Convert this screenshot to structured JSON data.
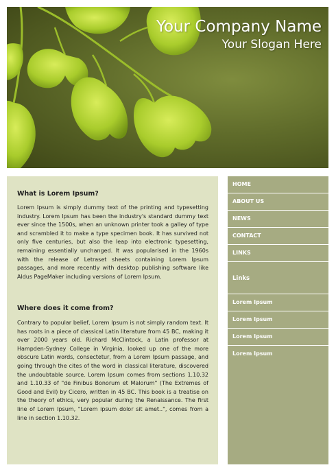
{
  "header": {
    "company_name": "Your Company Name",
    "slogan": "Your Slogan Here"
  },
  "content": {
    "sections": [
      {
        "heading": "What is Lorem Ipsum?",
        "body": "Lorem Ipsum is simply dummy text of the printing and typesetting industry. Lorem Ipsum has been the industry's standard dummy text ever since the 1500s, when an unknown printer took a galley of type and scrambled it to make a type specimen book. It has survived not only five centuries, but also the leap into electronic typesetting, remaining essentially unchanged. It was popularised in the 1960s with the release of Letraset sheets containing Lorem Ipsum passages, and more recently with desktop publishing software like Aldus PageMaker including versions of Lorem Ipsum."
      },
      {
        "heading": "Where does it come from?",
        "body": "Contrary to popular belief, Lorem Ipsum is not simply random text. It has roots in a piece of classical Latin literature from 45 BC, making it over 2000 years old. Richard McClintock, a Latin professor at Hampden-Sydney College in Virginia, looked up one of the more obscure Latin words, consectetur, from a Lorem Ipsum passage, and going through the cites of the word in classical literature, discovered the undoubtable source. Lorem Ipsum comes from sections 1.10.32 and 1.10.33 of \"de Finibus Bonorum et Malorum\" (The Extremes of Good and Evil) by Cicero, written in 45 BC. This book is a treatise on the theory of ethics, very popular during the Renaissance. The first line of Lorem Ipsum, \"Lorem ipsum dolor sit amet..\", comes from a line in section 1.10.32."
      }
    ]
  },
  "sidebar": {
    "nav": [
      "HOME",
      "ABOUT US",
      "NEWS",
      "CONTACT",
      "LINKS"
    ],
    "links_heading": "Links",
    "links": [
      "Lorem Ipsum",
      "Lorem Ipsum",
      "Lorem Ipsum",
      "Lorem Ipsum"
    ]
  },
  "colors": {
    "content_background": "#dfe3c4",
    "sidebar_background": "#a6ab82",
    "header_background": "#5f6b2a",
    "leaf_green": "#b4d43a"
  }
}
